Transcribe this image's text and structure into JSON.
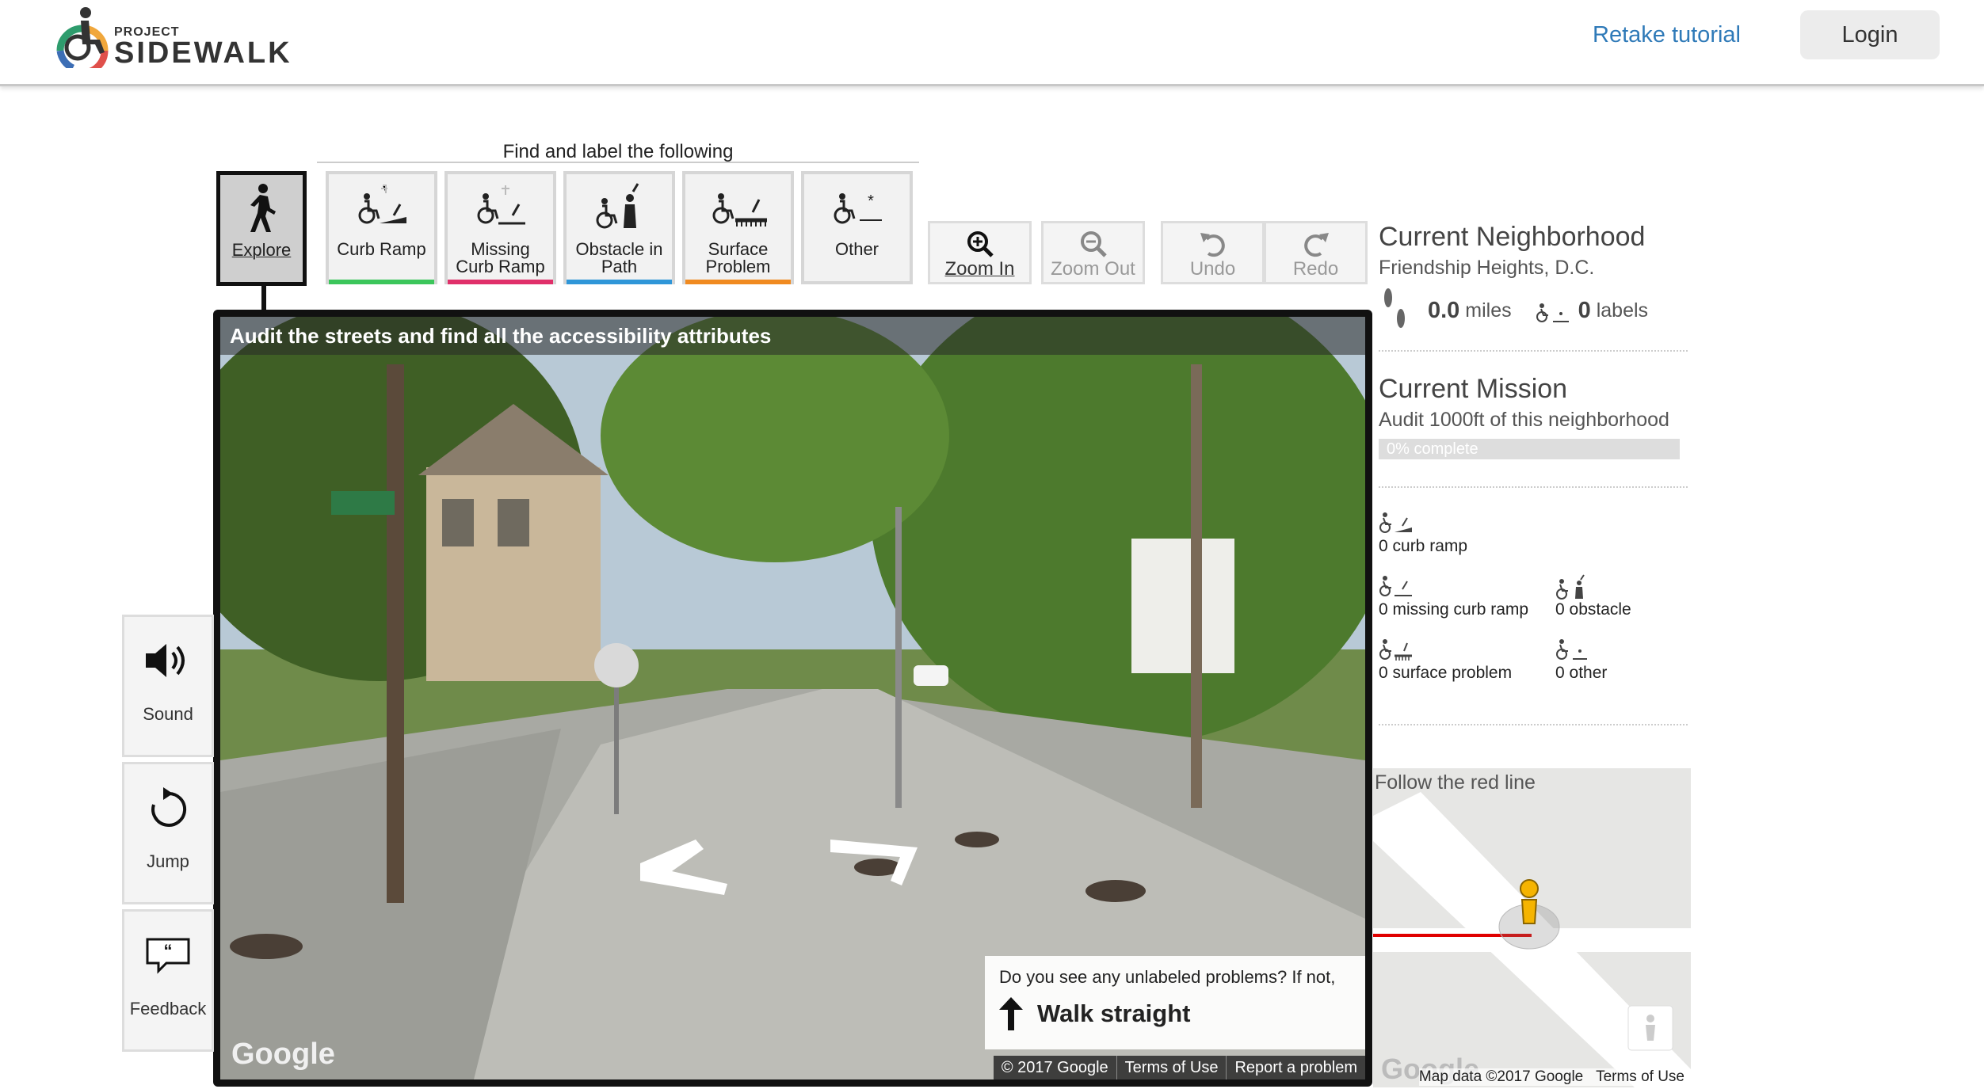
{
  "header": {
    "logo_small": "PROJECT",
    "logo_big": "SIDEWALK",
    "retake": "Retake tutorial",
    "login": "Login"
  },
  "toolbar": {
    "find_label": "Find and label the following",
    "modes": [
      {
        "label1": "Explore",
        "label2": "",
        "icon": "walking-person-icon"
      },
      {
        "label1": "Curb Ramp",
        "label2": "",
        "icon": "curb-ramp-icon",
        "color": "#3cc65b"
      },
      {
        "label1": "Missing",
        "label2": "Curb Ramp",
        "icon": "missing-curb-ramp-icon",
        "color": "#e0306a"
      },
      {
        "label1": "Obstacle in",
        "label2": "Path",
        "icon": "obstacle-icon",
        "color": "#2f96d8"
      },
      {
        "label1": "Surface",
        "label2": "Problem",
        "icon": "surface-problem-icon",
        "color": "#f08a20"
      },
      {
        "label1": "Other",
        "label2": "",
        "icon": "other-icon"
      }
    ],
    "tools": [
      {
        "label": "Zoom In",
        "icon": "zoom-in-icon"
      },
      {
        "label": "Zoom Out",
        "icon": "zoom-out-icon"
      },
      {
        "label": "Undo",
        "icon": "undo-icon"
      },
      {
        "label": "Redo",
        "icon": "redo-icon"
      }
    ]
  },
  "pano": {
    "title": "Audit the streets and find all the accessibility attributes",
    "google": "Google",
    "hint_q": "Do you see any unlabeled problems? If not,",
    "hint_action": "Walk straight",
    "footer": [
      "© 2017 Google",
      "Terms of Use",
      "Report a problem"
    ]
  },
  "side": {
    "sound": "Sound",
    "jump": "Jump",
    "feedback": "Feedback"
  },
  "neighborhood": {
    "heading": "Current Neighborhood",
    "name": "Friendship Heights, D.C.",
    "miles_value": "0.0",
    "miles_unit": "miles",
    "labels_value": "0",
    "labels_unit": "labels"
  },
  "mission": {
    "heading": "Current Mission",
    "desc": "Audit 1000ft of this neighborhood",
    "progress": "0% complete",
    "progress_fraction": 0
  },
  "counts": {
    "curb_ramp": "0 curb ramp",
    "missing_curb_ramp": "0 missing curb ramp",
    "obstacle": "0 obstacle",
    "surface_problem": "0 surface problem",
    "other": "0 other"
  },
  "map": {
    "label": "Follow the red line",
    "data": "Map data ©2017 Google",
    "terms": "Terms of Use",
    "google": "Google"
  }
}
